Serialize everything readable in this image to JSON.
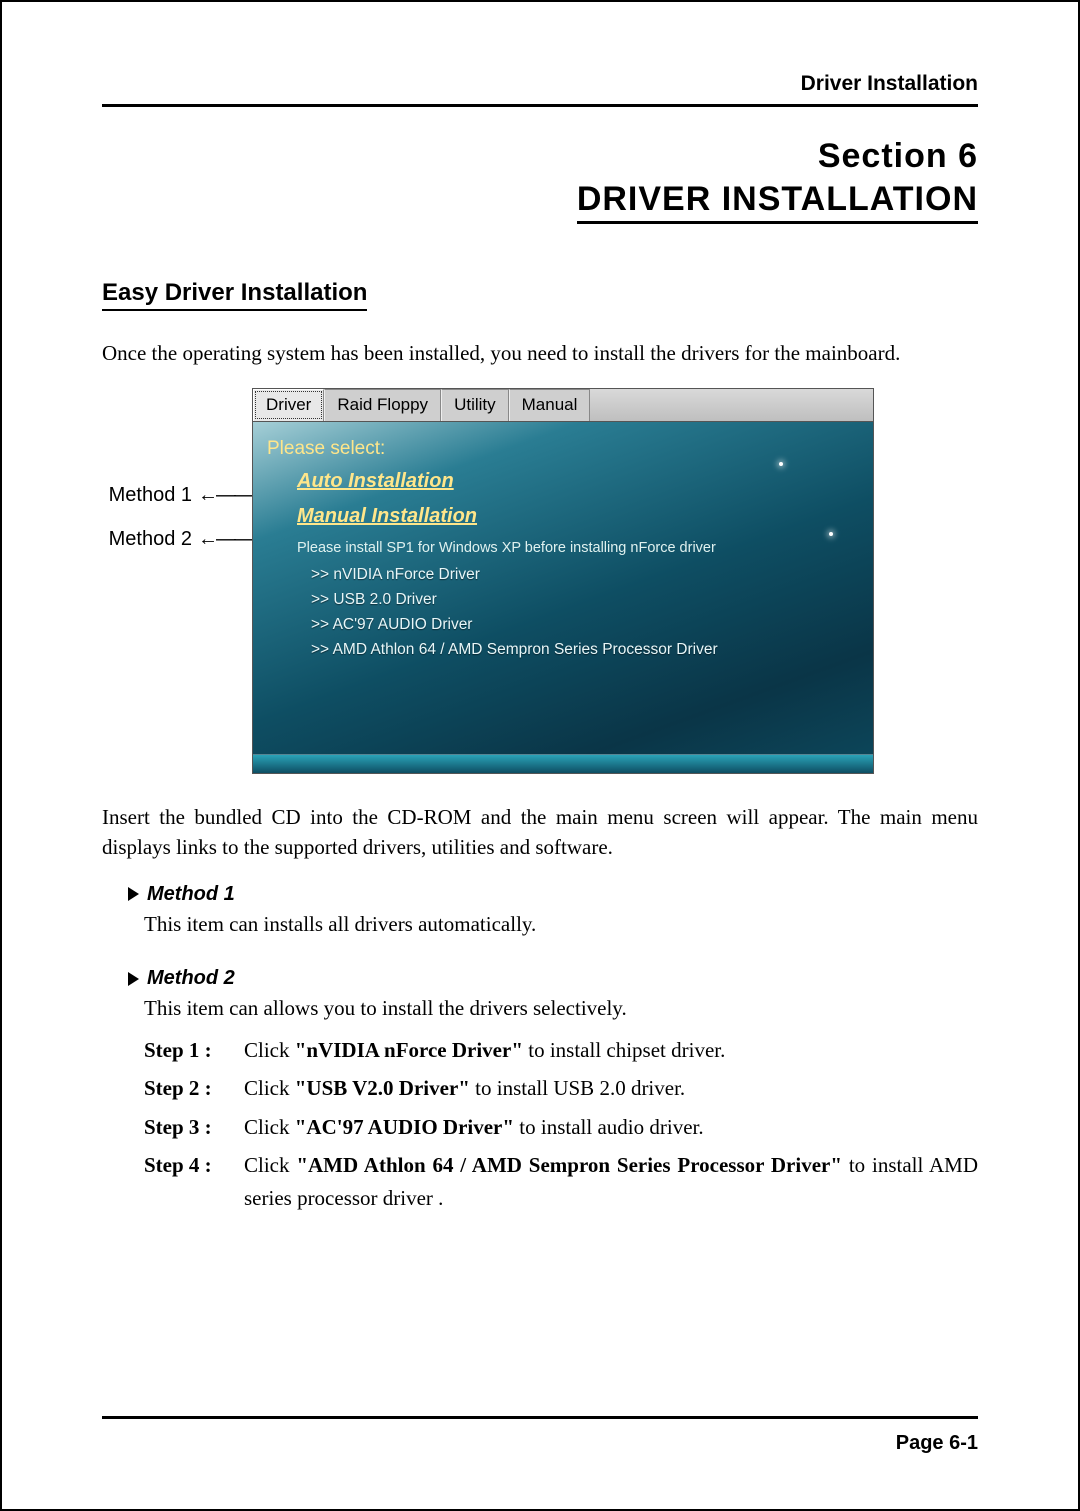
{
  "header": {
    "running": "Driver Installation"
  },
  "title": {
    "section": "Section 6",
    "main": "DRIVER INSTALLATION"
  },
  "subhead": "Easy Driver Installation",
  "intro": "Once the operating system has been installed, you need to install the drivers for the mainboard.",
  "labels": {
    "m1": "Method 1",
    "m2": "Method 2"
  },
  "shot": {
    "tabs": {
      "driver": "Driver",
      "raid": "Raid Floppy",
      "utility": "Utility",
      "manual": "Manual"
    },
    "please": "Please select:",
    "auto": "Auto Installation",
    "manualInst": "Manual Installation",
    "note": "Please install SP1 for Windows XP before installing nForce driver",
    "links": {
      "nvidia": "nVIDIA nForce Driver",
      "usb": "USB 2.0 Driver",
      "ac97": "AC'97 AUDIO Driver",
      "amd": "AMD Athlon 64 / AMD Sempron Series Processor Driver"
    }
  },
  "para2": "Insert the bundled CD into the CD-ROM and the main menu screen will appear. The main menu displays links to the supported drivers, utilities and software.",
  "m1": {
    "head": "Method 1",
    "text": "This item can installs all drivers automatically."
  },
  "m2": {
    "head": "Method 2",
    "text": "This item can allows you to install the drivers selectively.",
    "steps": {
      "s1": {
        "lbl": "Step 1 :",
        "pre": "Click ",
        "bold": "\"nVIDIA nForce Driver\"",
        "post": " to install chipset driver."
      },
      "s2": {
        "lbl": "Step 2 :",
        "pre": "Click ",
        "bold": "\"USB V2.0 Driver\"",
        "post": " to install USB 2.0 driver."
      },
      "s3": {
        "lbl": "Step 3 :",
        "pre": "Click ",
        "bold": "\"AC'97 AUDIO Driver\"",
        "post": " to install audio driver."
      },
      "s4": {
        "lbl": "Step 4 :",
        "pre": "Click ",
        "bold": "\"AMD Athlon 64 / AMD Sempron Series Processor Driver\"",
        "post": " to install AMD series processor driver ."
      }
    }
  },
  "footer": {
    "page": "Page 6-1"
  }
}
